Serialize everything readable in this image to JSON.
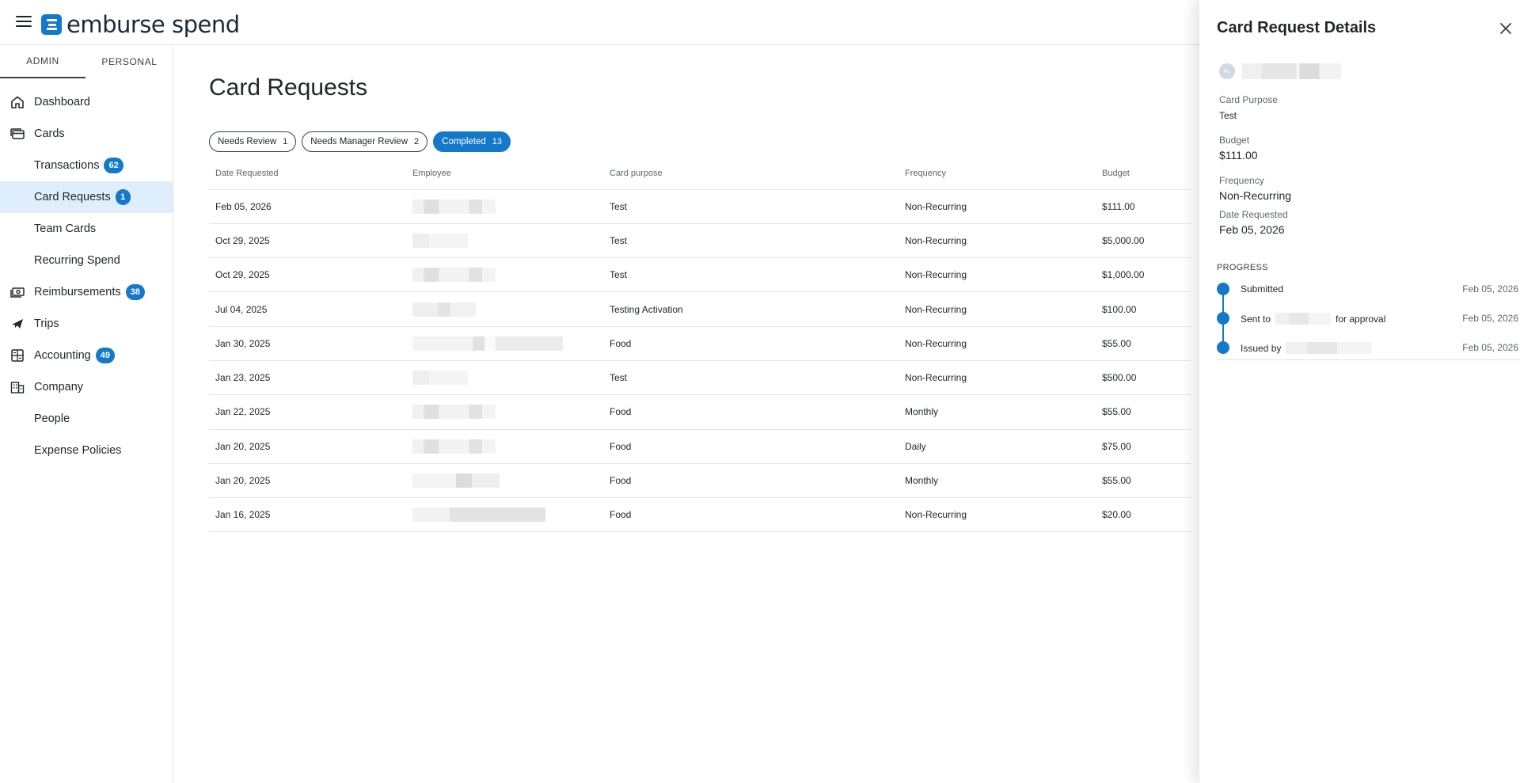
{
  "app": {
    "logo_text": "emburse spend"
  },
  "sidebar": {
    "tabs": [
      {
        "label": "ADMIN"
      },
      {
        "label": "PERSONAL"
      }
    ],
    "items": [
      {
        "label": "Dashboard",
        "icon": "home-icon"
      },
      {
        "label": "Cards",
        "icon": "cards-icon"
      },
      {
        "label": "Transactions",
        "badge": "62"
      },
      {
        "label": "Card Requests",
        "badge": "1",
        "active": true
      },
      {
        "label": "Team Cards"
      },
      {
        "label": "Recurring Spend"
      },
      {
        "label": "Reimbursements",
        "badge": "38",
        "icon": "money-icon"
      },
      {
        "label": "Trips",
        "icon": "plane-icon"
      },
      {
        "label": "Accounting",
        "badge": "49",
        "icon": "calculator-icon"
      },
      {
        "label": "Company",
        "icon": "building-icon"
      },
      {
        "label": "People"
      },
      {
        "label": "Expense Policies"
      }
    ]
  },
  "main": {
    "title": "Card Requests",
    "filters": [
      {
        "label": "Needs Review",
        "count": "1"
      },
      {
        "label": "Needs Manager Review",
        "count": "2"
      },
      {
        "label": "Completed",
        "count": "13",
        "active": true
      }
    ],
    "table": {
      "columns": [
        "Date Requested",
        "Employee",
        "Card purpose",
        "Frequency",
        "Budget"
      ],
      "rows": [
        {
          "date": "Feb 05, 2026",
          "purpose": "Test",
          "frequency": "Non-Recurring",
          "budget": "$111.00"
        },
        {
          "date": "Oct 29, 2025",
          "purpose": "Test",
          "frequency": "Non-Recurring",
          "budget": "$5,000.00"
        },
        {
          "date": "Oct 29, 2025",
          "purpose": "Test",
          "frequency": "Non-Recurring",
          "budget": "$1,000.00"
        },
        {
          "date": "Jul 04, 2025",
          "purpose": "Testing Activation",
          "frequency": "Non-Recurring",
          "budget": "$100.00"
        },
        {
          "date": "Jan 30, 2025",
          "purpose": "Food",
          "frequency": "Non-Recurring",
          "budget": "$55.00"
        },
        {
          "date": "Jan 23, 2025",
          "purpose": "Test",
          "frequency": "Non-Recurring",
          "budget": "$500.00"
        },
        {
          "date": "Jan 22, 2025",
          "purpose": "Food",
          "frequency": "Monthly",
          "budget": "$55.00"
        },
        {
          "date": "Jan 20, 2025",
          "purpose": "Food",
          "frequency": "Daily",
          "budget": "$75.00"
        },
        {
          "date": "Jan 20, 2025",
          "purpose": "Food",
          "frequency": "Monthly",
          "budget": "$55.00"
        },
        {
          "date": "Jan 16, 2025",
          "purpose": "Food",
          "frequency": "Non-Recurring",
          "budget": "$20.00"
        }
      ]
    }
  },
  "drawer": {
    "title": "Card Request Details",
    "avatar_initials": "AL",
    "card_purpose_label": "Card Purpose",
    "card_purpose_value": "Test",
    "budget_label": "Budget",
    "budget_value": "$111.00",
    "frequency_label": "Frequency",
    "frequency_value": "Non-Recurring",
    "date_label": "Date Requested",
    "date_value": "Feb 05, 2026",
    "progress_label": "PROGRESS",
    "progress": {
      "submitted": {
        "text": "Submitted",
        "date": "Feb 05, 2026"
      },
      "sent": {
        "prefix": "Sent to",
        "suffix": "for approval",
        "date": "Feb 05, 2026"
      },
      "issued": {
        "prefix": "Issued by",
        "date": "Feb 05, 2026"
      }
    }
  },
  "colors": {
    "accent": "#1479c9",
    "active_nav_bg": "#dfeefb"
  }
}
